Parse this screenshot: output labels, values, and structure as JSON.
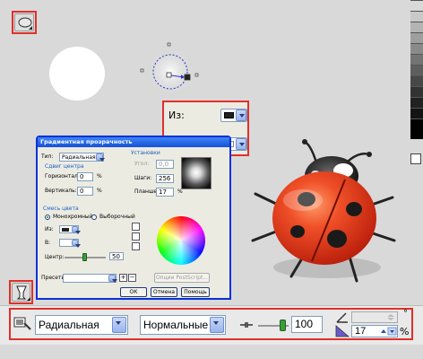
{
  "toolbar_top": {
    "shape_icon": "oval-tool-icon"
  },
  "popup": {
    "from_label": "Из:",
    "to_label": "В:",
    "from_color": "#222222",
    "to_color": "#ffffff"
  },
  "dialog": {
    "title": "Градиентная прозрачность",
    "type_label": "Тип:",
    "type_value": "Радиальная",
    "center_shift_header": "Сдвиг центра",
    "horizontal_label": "Горизонталь:",
    "horizontal_value": "0",
    "vertical_label": "Вертикаль:",
    "vertical_value": "0",
    "percent": "%",
    "settings_header": "Установки",
    "angle_label": "Угол:",
    "angle_value": "0,0",
    "steps_label": "Шаги:",
    "steps_value": "256",
    "padding_label": "Планшет:",
    "padding_value": "17",
    "color_mix_header": "Смесь цвета",
    "mono_label": "Монохромный",
    "custom_label": "Выборочный",
    "from_label": "Из:",
    "to_label": "В:",
    "center_label": "Центр:",
    "center_value": "50",
    "presets_label": "Пресеты:",
    "postscript_button": "Опции PostScript...",
    "ok_button": "ОК",
    "cancel_button": "Отмена",
    "help_button": "Помощь"
  },
  "bottom_toolbar": {
    "type_value": "Радиальная",
    "mode_value": "Нормальные",
    "midpoint_value": "100",
    "angle_value": "",
    "padding_value": "17",
    "percent_label": "%",
    "degree_label": "°"
  },
  "colors": {
    "background": "#d9d9d9",
    "highlight_border": "#e0302a",
    "ladybug_red": "#e43a1a",
    "dialog_title_blue": "#2256d8"
  }
}
